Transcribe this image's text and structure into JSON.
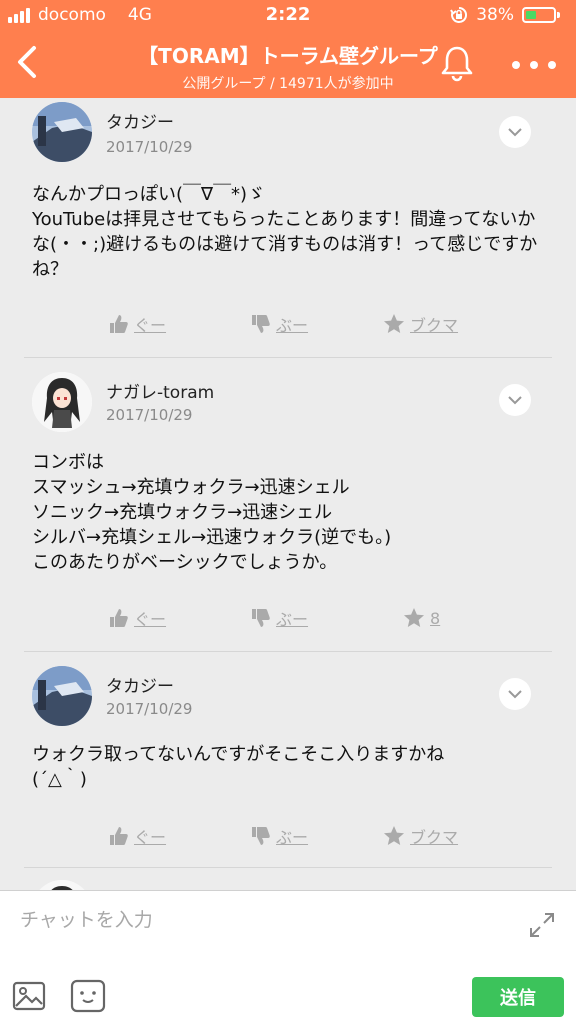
{
  "status_bar": {
    "carrier": "docomo",
    "network": "4G",
    "time": "2:22",
    "battery": "38%",
    "battery_level": 0.38
  },
  "header": {
    "title": "【TORAM】トーラム壁グループ",
    "subtitle": "公開グループ / 14971人が参加中",
    "accent": "#ff7f4e"
  },
  "posts": [
    {
      "author": "タカジー",
      "date": "2017/10/29",
      "body": "なんかプロっぽい(￣∇￣*)ゞ\nYouTubeは拝見させてもらったことあります！間違ってないかな(・・;)避けるものは避けて消すものは消す！って感じですかね？",
      "like_label": "ぐー",
      "dislike_label": "ぶー",
      "bookmark_label": "ブクマ"
    },
    {
      "author": "ナガレ-toram",
      "date": "2017/10/29",
      "body": "コンボは\nスマッシュ→充填ウォクラ→迅速シェル\nソニック→充填ウォクラ→迅速シェル\nシルバ→充填シェル→迅速ウォクラ(逆でも。)\nこのあたりがベーシックでしょうか。",
      "like_label": "ぐー",
      "dislike_label": "ぶー",
      "bookmark_label": "8"
    },
    {
      "author": "タカジー",
      "date": "2017/10/29",
      "body": "ウォクラ取ってないんですがそこそこ入りますかね\n(´△｀)",
      "like_label": "ぐー",
      "dislike_label": "ぶー",
      "bookmark_label": "ブクマ"
    }
  ],
  "composer": {
    "placeholder": "チャットを入力",
    "send_label": "送信",
    "send_color": "#3cc35b"
  }
}
